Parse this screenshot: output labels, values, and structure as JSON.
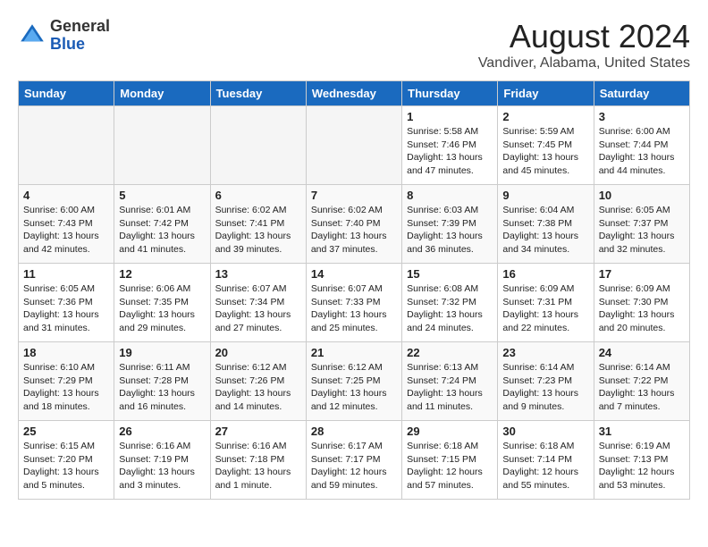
{
  "header": {
    "logo_line1": "General",
    "logo_line2": "Blue",
    "title": "August 2024",
    "subtitle": "Vandiver, Alabama, United States"
  },
  "days_of_week": [
    "Sunday",
    "Monday",
    "Tuesday",
    "Wednesday",
    "Thursday",
    "Friday",
    "Saturday"
  ],
  "weeks": [
    [
      {
        "day": "",
        "info": ""
      },
      {
        "day": "",
        "info": ""
      },
      {
        "day": "",
        "info": ""
      },
      {
        "day": "",
        "info": ""
      },
      {
        "day": "1",
        "info": "Sunrise: 5:58 AM\nSunset: 7:46 PM\nDaylight: 13 hours\nand 47 minutes."
      },
      {
        "day": "2",
        "info": "Sunrise: 5:59 AM\nSunset: 7:45 PM\nDaylight: 13 hours\nand 45 minutes."
      },
      {
        "day": "3",
        "info": "Sunrise: 6:00 AM\nSunset: 7:44 PM\nDaylight: 13 hours\nand 44 minutes."
      }
    ],
    [
      {
        "day": "4",
        "info": "Sunrise: 6:00 AM\nSunset: 7:43 PM\nDaylight: 13 hours\nand 42 minutes."
      },
      {
        "day": "5",
        "info": "Sunrise: 6:01 AM\nSunset: 7:42 PM\nDaylight: 13 hours\nand 41 minutes."
      },
      {
        "day": "6",
        "info": "Sunrise: 6:02 AM\nSunset: 7:41 PM\nDaylight: 13 hours\nand 39 minutes."
      },
      {
        "day": "7",
        "info": "Sunrise: 6:02 AM\nSunset: 7:40 PM\nDaylight: 13 hours\nand 37 minutes."
      },
      {
        "day": "8",
        "info": "Sunrise: 6:03 AM\nSunset: 7:39 PM\nDaylight: 13 hours\nand 36 minutes."
      },
      {
        "day": "9",
        "info": "Sunrise: 6:04 AM\nSunset: 7:38 PM\nDaylight: 13 hours\nand 34 minutes."
      },
      {
        "day": "10",
        "info": "Sunrise: 6:05 AM\nSunset: 7:37 PM\nDaylight: 13 hours\nand 32 minutes."
      }
    ],
    [
      {
        "day": "11",
        "info": "Sunrise: 6:05 AM\nSunset: 7:36 PM\nDaylight: 13 hours\nand 31 minutes."
      },
      {
        "day": "12",
        "info": "Sunrise: 6:06 AM\nSunset: 7:35 PM\nDaylight: 13 hours\nand 29 minutes."
      },
      {
        "day": "13",
        "info": "Sunrise: 6:07 AM\nSunset: 7:34 PM\nDaylight: 13 hours\nand 27 minutes."
      },
      {
        "day": "14",
        "info": "Sunrise: 6:07 AM\nSunset: 7:33 PM\nDaylight: 13 hours\nand 25 minutes."
      },
      {
        "day": "15",
        "info": "Sunrise: 6:08 AM\nSunset: 7:32 PM\nDaylight: 13 hours\nand 24 minutes."
      },
      {
        "day": "16",
        "info": "Sunrise: 6:09 AM\nSunset: 7:31 PM\nDaylight: 13 hours\nand 22 minutes."
      },
      {
        "day": "17",
        "info": "Sunrise: 6:09 AM\nSunset: 7:30 PM\nDaylight: 13 hours\nand 20 minutes."
      }
    ],
    [
      {
        "day": "18",
        "info": "Sunrise: 6:10 AM\nSunset: 7:29 PM\nDaylight: 13 hours\nand 18 minutes."
      },
      {
        "day": "19",
        "info": "Sunrise: 6:11 AM\nSunset: 7:28 PM\nDaylight: 13 hours\nand 16 minutes."
      },
      {
        "day": "20",
        "info": "Sunrise: 6:12 AM\nSunset: 7:26 PM\nDaylight: 13 hours\nand 14 minutes."
      },
      {
        "day": "21",
        "info": "Sunrise: 6:12 AM\nSunset: 7:25 PM\nDaylight: 13 hours\nand 12 minutes."
      },
      {
        "day": "22",
        "info": "Sunrise: 6:13 AM\nSunset: 7:24 PM\nDaylight: 13 hours\nand 11 minutes."
      },
      {
        "day": "23",
        "info": "Sunrise: 6:14 AM\nSunset: 7:23 PM\nDaylight: 13 hours\nand 9 minutes."
      },
      {
        "day": "24",
        "info": "Sunrise: 6:14 AM\nSunset: 7:22 PM\nDaylight: 13 hours\nand 7 minutes."
      }
    ],
    [
      {
        "day": "25",
        "info": "Sunrise: 6:15 AM\nSunset: 7:20 PM\nDaylight: 13 hours\nand 5 minutes."
      },
      {
        "day": "26",
        "info": "Sunrise: 6:16 AM\nSunset: 7:19 PM\nDaylight: 13 hours\nand 3 minutes."
      },
      {
        "day": "27",
        "info": "Sunrise: 6:16 AM\nSunset: 7:18 PM\nDaylight: 13 hours\nand 1 minute."
      },
      {
        "day": "28",
        "info": "Sunrise: 6:17 AM\nSunset: 7:17 PM\nDaylight: 12 hours\nand 59 minutes."
      },
      {
        "day": "29",
        "info": "Sunrise: 6:18 AM\nSunset: 7:15 PM\nDaylight: 12 hours\nand 57 minutes."
      },
      {
        "day": "30",
        "info": "Sunrise: 6:18 AM\nSunset: 7:14 PM\nDaylight: 12 hours\nand 55 minutes."
      },
      {
        "day": "31",
        "info": "Sunrise: 6:19 AM\nSunset: 7:13 PM\nDaylight: 12 hours\nand 53 minutes."
      }
    ]
  ]
}
